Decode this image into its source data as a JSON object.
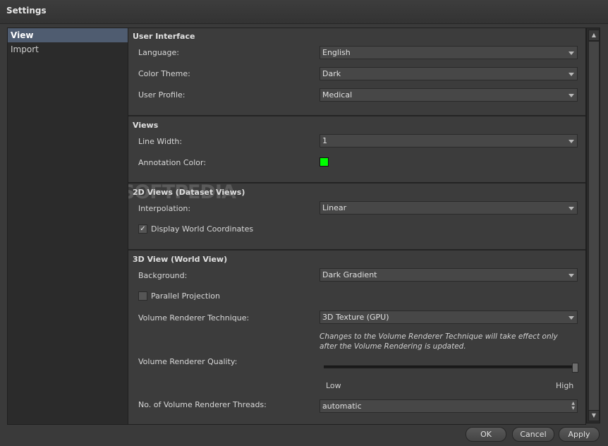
{
  "window": {
    "title": "Settings"
  },
  "sidebar": {
    "items": [
      {
        "label": "View"
      },
      {
        "label": "Import"
      }
    ]
  },
  "sections": {
    "ui": {
      "title": "User Interface",
      "language": {
        "label": "Language:",
        "value": "English"
      },
      "color_theme": {
        "label": "Color Theme:",
        "value": "Dark"
      },
      "user_profile": {
        "label": "User Profile:",
        "value": "Medical"
      }
    },
    "views": {
      "title": "Views",
      "line_width": {
        "label": "Line Width:",
        "value": "1"
      },
      "annotation_color": {
        "label": "Annotation Color:",
        "color": "#00ff00"
      }
    },
    "views2d": {
      "title": "2D Views (Dataset Views)",
      "interpolation": {
        "label": "Interpolation:",
        "value": "Linear"
      },
      "display_world": {
        "label": "Display World Coordinates",
        "checked": true
      }
    },
    "view3d": {
      "title": "3D View (World View)",
      "background": {
        "label": "Background:",
        "value": "Dark Gradient"
      },
      "parallel_projection": {
        "label": "Parallel Projection",
        "checked": false
      },
      "technique": {
        "label": "Volume Renderer Technique:",
        "value": "3D Texture (GPU)"
      },
      "note": "Changes to the Volume Renderer Technique will take effect only after the Volume Rendering is updated.",
      "quality": {
        "label": "Volume Renderer Quality:",
        "low": "Low",
        "high": "High",
        "level": 1.0
      },
      "threads": {
        "label": "No. of Volume Renderer Threads:",
        "value": "automatic"
      }
    }
  },
  "buttons": {
    "ok": "OK",
    "cancel": "Cancel",
    "apply": "Apply"
  },
  "watermark": "SOFTPEDIA"
}
